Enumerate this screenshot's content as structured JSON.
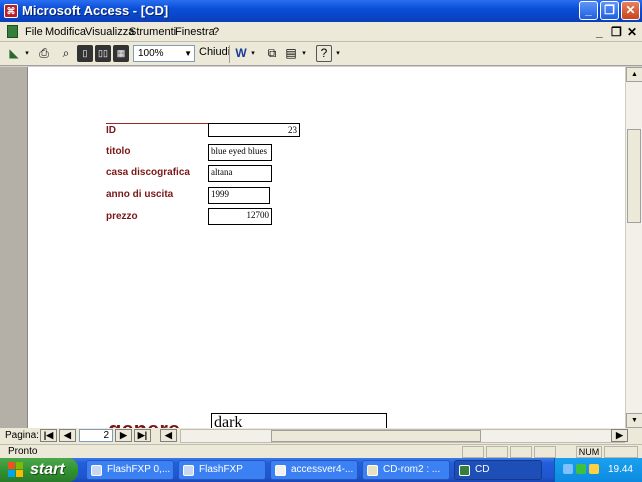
{
  "window": {
    "title": "Microsoft Access - [CD]",
    "app_icon": "access-icon",
    "controls": [
      "_",
      "❐",
      "✕"
    ]
  },
  "menu": {
    "items": [
      "File",
      "Modifica",
      "Visualizza",
      "Strumenti",
      "Finestra",
      "?"
    ],
    "mdi_controls": [
      "_",
      "❐",
      "✕"
    ]
  },
  "toolbar": {
    "zoom": "100%",
    "close_label": "Chiudi"
  },
  "form": {
    "fields": [
      {
        "label": "ID",
        "value": "23"
      },
      {
        "label": "titolo",
        "value": "blue eyed blues"
      },
      {
        "label": "casa discografica",
        "value": "altana"
      },
      {
        "label": "anno di uscita",
        "value": "1999"
      },
      {
        "label": "prezzo",
        "value": "12700"
      }
    ],
    "genre_label": "genere",
    "genre_value": "dark"
  },
  "navigation": {
    "label": "Pagina:",
    "page": "2"
  },
  "status": {
    "text": "Pronto",
    "indicator": "NUM"
  },
  "taskbar": {
    "start_label": "start",
    "tasks": [
      {
        "label": "FlashFXP 0,...",
        "active": false
      },
      {
        "label": "FlashFXP",
        "active": false
      },
      {
        "label": "accessver4-...",
        "active": false
      },
      {
        "label": "CD-rom2 : ...",
        "active": false
      },
      {
        "label": "CD",
        "active": true
      }
    ],
    "clock": "19.44"
  }
}
